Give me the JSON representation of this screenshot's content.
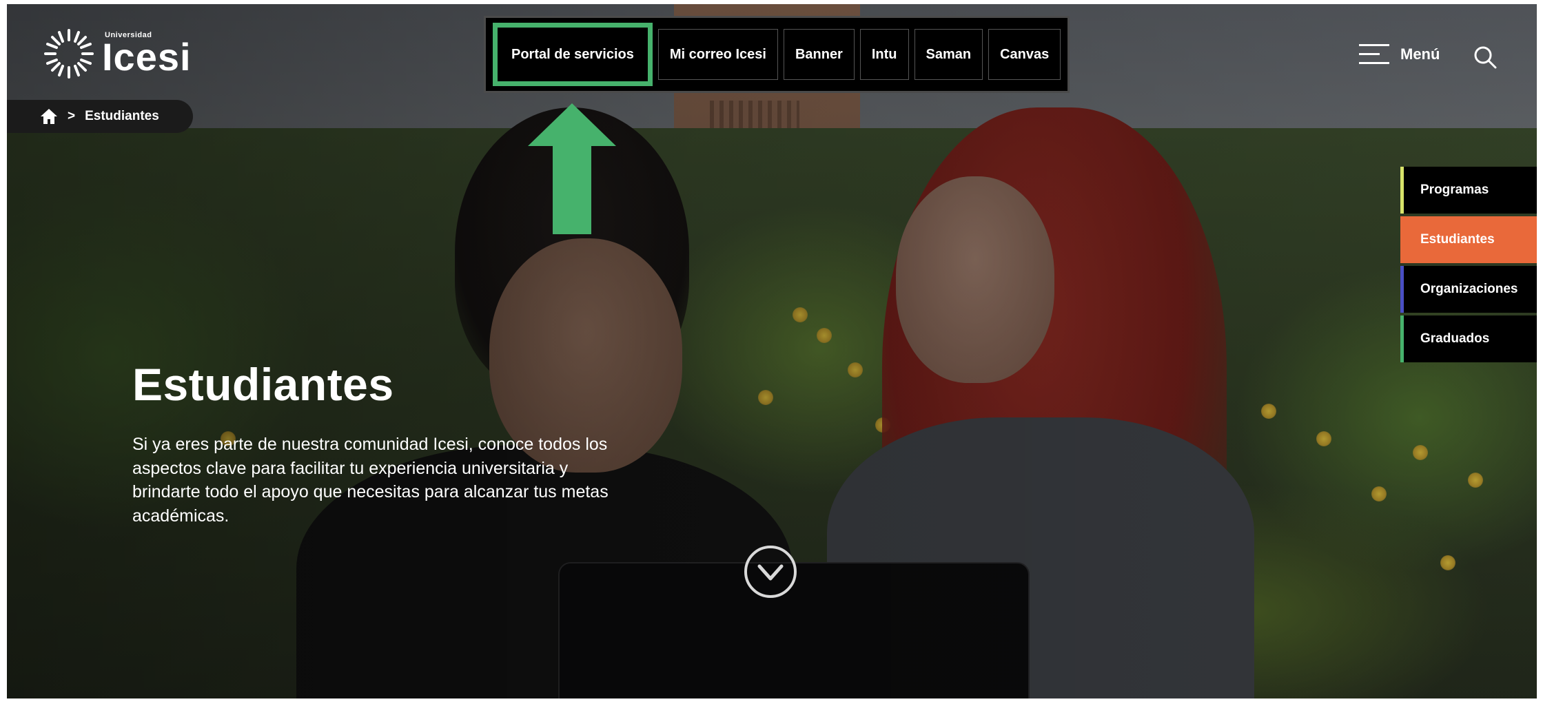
{
  "brand": {
    "logo_small": "Universidad",
    "logo_big": "Icesi"
  },
  "topnav": {
    "items": [
      {
        "label": "Portal de servicios",
        "highlighted": true
      },
      {
        "label": "Mi correo Icesi"
      },
      {
        "label": "Banner"
      },
      {
        "label": "Intu"
      },
      {
        "label": "Saman"
      },
      {
        "label": "Canvas"
      }
    ]
  },
  "header": {
    "menu_label": "Menú",
    "menu_icon": "hamburger-icon",
    "search_icon": "search-icon"
  },
  "breadcrumb": {
    "home_icon": "home-icon",
    "separator": ">",
    "current": "Estudiantes"
  },
  "sidetabs": {
    "items": [
      {
        "label": "Programas",
        "accent": "#d8e36a",
        "bg": "#000000"
      },
      {
        "label": "Estudiantes",
        "accent": "#e9693a",
        "bg": "#e9693a"
      },
      {
        "label": "Organizaciones",
        "accent": "#4a4fc4",
        "bg": "#000000"
      },
      {
        "label": "Graduados",
        "accent": "#46b26c",
        "bg": "#000000"
      }
    ]
  },
  "hero": {
    "title": "Estudiantes",
    "description": "Si ya eres parte de nuestra comunidad Icesi, conoce todos los aspectos clave para facilitar tu experiencia universitaria y brindarte todo el apoyo que necesitas para alcanzar tus metas académicas.",
    "scroll_icon": "chevron-down-circle-icon"
  },
  "annotation": {
    "arrow_color": "#46b26c",
    "highlight_color": "#46b26c"
  }
}
